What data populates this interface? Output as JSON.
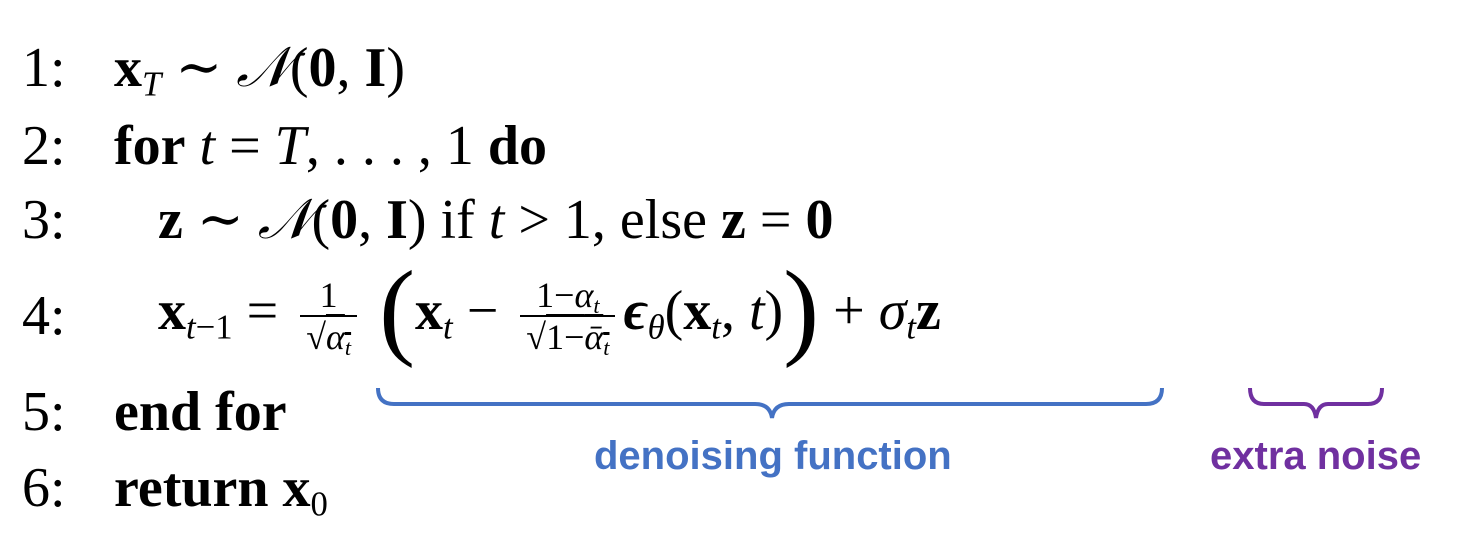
{
  "algorithm": {
    "lines": [
      {
        "number": "1:"
      },
      {
        "number": "2:",
        "keyword_for": "for",
        "keyword_do": "do"
      },
      {
        "number": "3:",
        "text_if": "if",
        "text_else": "else"
      },
      {
        "number": "4:"
      },
      {
        "number": "5:",
        "keyword": "end for"
      },
      {
        "number": "6:",
        "keyword": "return"
      }
    ]
  },
  "annotations": {
    "denoising": {
      "label": "denoising function",
      "color": "#4472c4"
    },
    "extra_noise": {
      "label": "extra noise",
      "color": "#7030a0"
    }
  }
}
